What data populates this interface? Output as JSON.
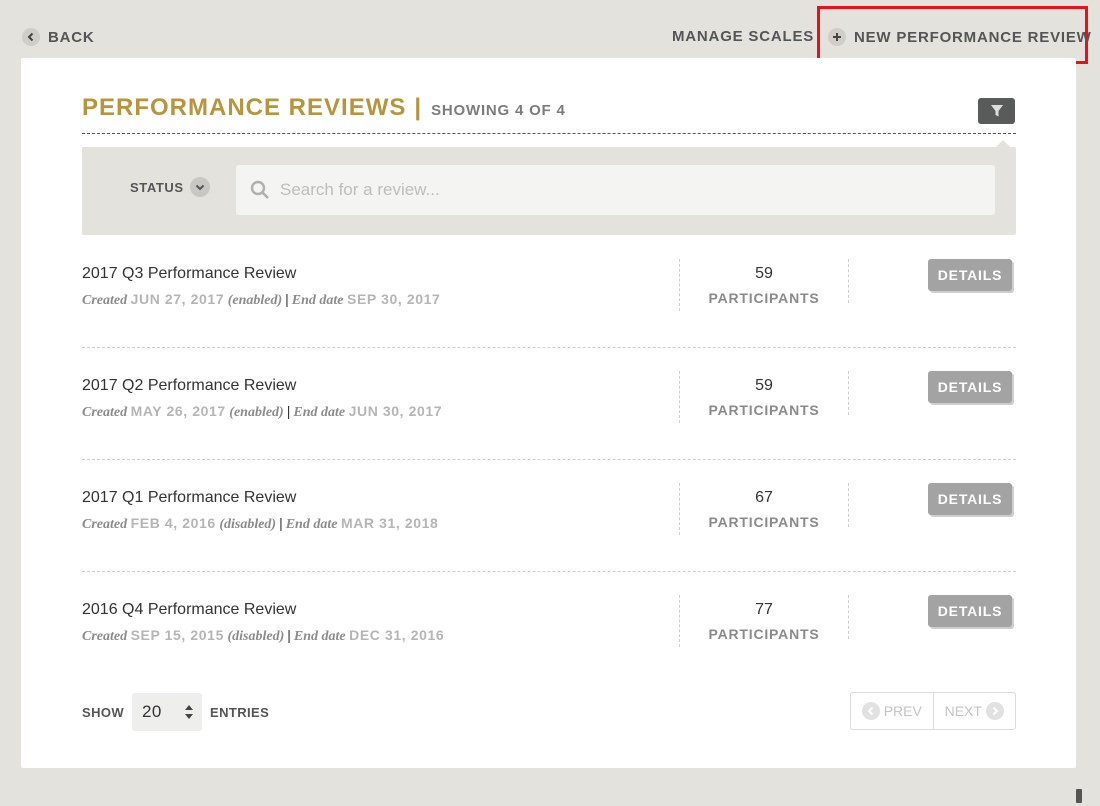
{
  "topbar": {
    "back_label": "BACK",
    "manage_scales_label": "MANAGE SCALES",
    "new_review_label": "NEW PERFORMANCE REVIEW"
  },
  "header": {
    "title": "PERFORMANCE REVIEWS",
    "separator": "|",
    "showing": "SHOWING 4 OF 4"
  },
  "filters": {
    "status_label": "STATUS",
    "search_placeholder": "Search for a review...",
    "search_value": ""
  },
  "reviews": [
    {
      "name": "2017 Q3 Performance Review",
      "created_label": "Created",
      "created_date": "JUN 27, 2017",
      "state": "(enabled)",
      "end_label": "End date",
      "end_date": "SEP 30, 2017",
      "participants": "59",
      "participants_label": "PARTICIPANTS",
      "details_label": "DETAILS"
    },
    {
      "name": "2017 Q2 Performance Review",
      "created_label": "Created",
      "created_date": "MAY 26, 2017",
      "state": "(enabled)",
      "end_label": "End date",
      "end_date": "JUN 30, 2017",
      "participants": "59",
      "participants_label": "PARTICIPANTS",
      "details_label": "DETAILS"
    },
    {
      "name": "2017 Q1 Performance Review",
      "created_label": "Created",
      "created_date": "FEB 4, 2016",
      "state": "(disabled)",
      "end_label": "End date",
      "end_date": "MAR 31, 2018",
      "participants": "67",
      "participants_label": "PARTICIPANTS",
      "details_label": "DETAILS"
    },
    {
      "name": "2016 Q4 Performance Review",
      "created_label": "Created",
      "created_date": "SEP 15, 2015",
      "state": "(disabled)",
      "end_label": "End date",
      "end_date": "DEC 31, 2016",
      "participants": "77",
      "participants_label": "PARTICIPANTS",
      "details_label": "DETAILS"
    }
  ],
  "footer": {
    "show_label": "SHOW",
    "entries_value": "20",
    "entries_label": "ENTRIES",
    "prev_label": "PREV",
    "next_label": "NEXT"
  },
  "colors": {
    "accent_gold": "#b8943d",
    "page_bg": "#e3e2dd",
    "highlight_red": "#e8101a",
    "button_gray": "#a3a3a3"
  },
  "icons": {
    "back": "chevron-left-icon",
    "new_review": "plus-icon",
    "filter": "filter-funnel-icon",
    "status": "chevron-down-icon",
    "search": "search-icon",
    "entries": "up-down-arrows-icon",
    "prev": "chevron-left-icon",
    "next": "chevron-right-icon"
  }
}
